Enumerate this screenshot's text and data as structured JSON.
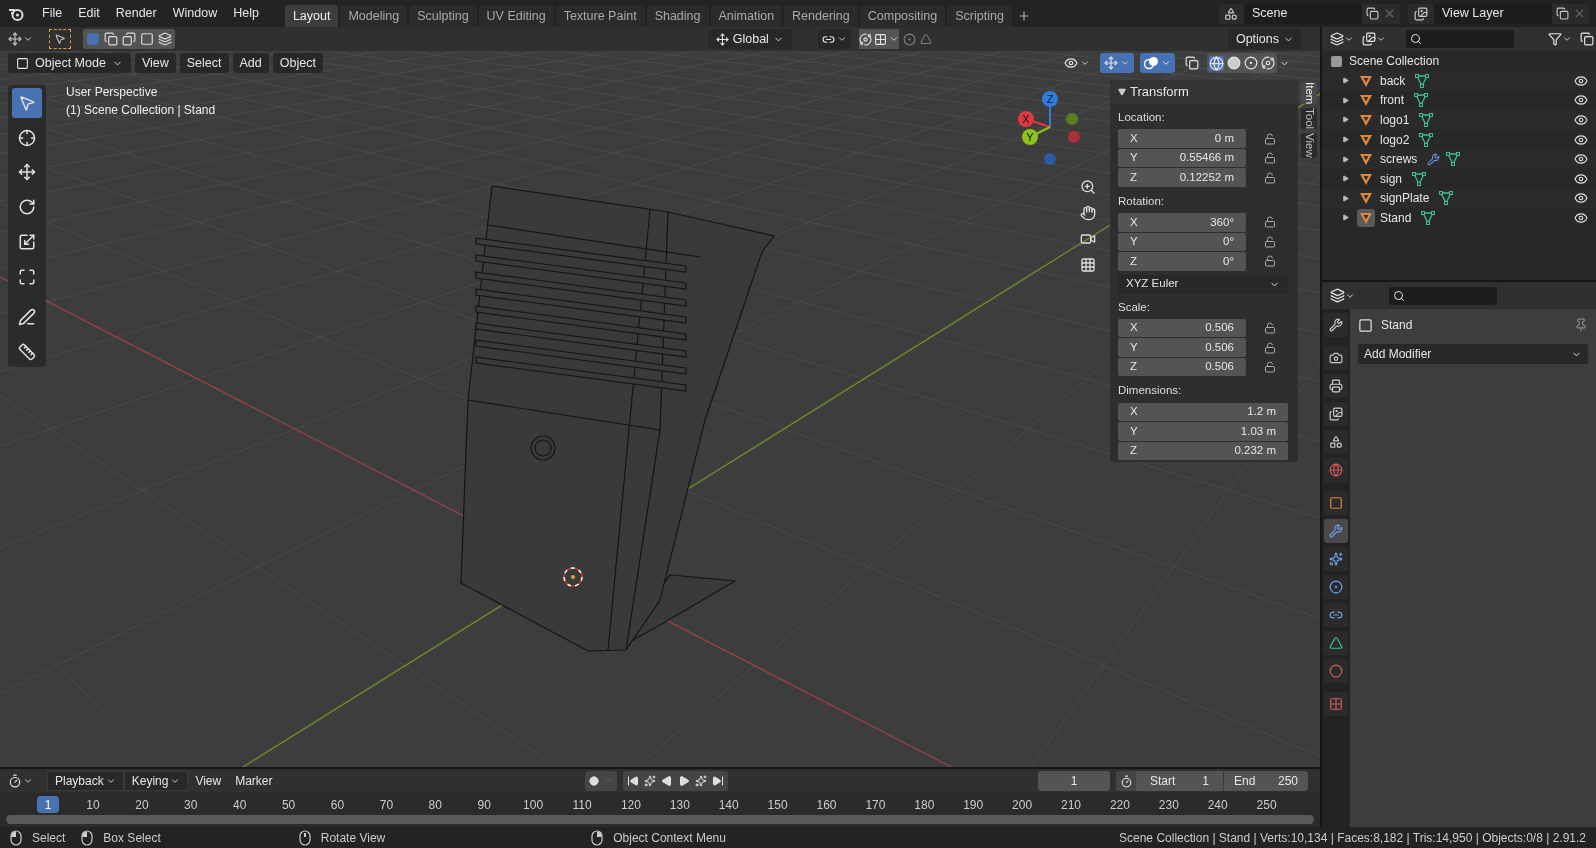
{
  "menu": [
    "File",
    "Edit",
    "Render",
    "Window",
    "Help"
  ],
  "workspaces": [
    {
      "label": "Layout",
      "selected": true
    },
    {
      "label": "Modeling",
      "selected": false
    },
    {
      "label": "Sculpting",
      "selected": false
    },
    {
      "label": "UV Editing",
      "selected": false
    },
    {
      "label": "Texture Paint",
      "selected": false
    },
    {
      "label": "Shading",
      "selected": false
    },
    {
      "label": "Animation",
      "selected": false
    },
    {
      "label": "Rendering",
      "selected": false
    },
    {
      "label": "Compositing",
      "selected": false
    },
    {
      "label": "Scripting",
      "selected": false
    }
  ],
  "scene": "Scene",
  "view_layer": "View Layer",
  "tool_header": {
    "orientation": "Global",
    "snap_on": true,
    "options": "Options"
  },
  "viewport_header": {
    "mode": "Object Mode",
    "menus": [
      "View",
      "Select",
      "Add",
      "Object"
    ],
    "gizmos_on": true,
    "overlays_on": true
  },
  "viewport_info": [
    "User Perspective",
    "(1) Scene Collection | Stand"
  ],
  "tools": [
    {
      "kind": "select",
      "selected": true
    },
    {
      "kind": "cursor",
      "selected": false
    },
    {
      "kind": "move",
      "selected": false
    },
    {
      "kind": "rotate",
      "selected": false
    },
    {
      "kind": "scale",
      "selected": false
    },
    {
      "kind": "transform",
      "selected": false
    },
    {
      "kind": "annotate",
      "selected": false
    },
    {
      "kind": "measure",
      "selected": false
    }
  ],
  "gizmo": [
    {
      "label": "Z",
      "color": "#2f7ce0"
    },
    {
      "label": "X",
      "color": "#e0393d"
    },
    {
      "label": "Y",
      "color": "#8cc31b"
    }
  ],
  "n_panel": {
    "tabs": [
      {
        "label": "Item",
        "selected": true
      },
      {
        "label": "Tool",
        "selected": false
      },
      {
        "label": "View",
        "selected": false
      }
    ],
    "title": "Transform",
    "sections": [
      {
        "label": "Location:",
        "locks": true,
        "fields": [
          {
            "axis": "X",
            "value": "0 m"
          },
          {
            "axis": "Y",
            "value": "0.55466 m"
          },
          {
            "axis": "Z",
            "value": "0.12252 m"
          }
        ]
      },
      {
        "label": "Rotation:",
        "locks": true,
        "fields": [
          {
            "axis": "X",
            "value": "360°"
          },
          {
            "axis": "Y",
            "value": "0°"
          },
          {
            "axis": "Z",
            "value": "0°"
          }
        ],
        "mode": "XYZ Euler"
      },
      {
        "label": "Scale:",
        "locks": true,
        "fields": [
          {
            "axis": "X",
            "value": "0.506"
          },
          {
            "axis": "Y",
            "value": "0.506"
          },
          {
            "axis": "Z",
            "value": "0.506"
          }
        ]
      },
      {
        "label": "Dimensions:",
        "locks": false,
        "fields": [
          {
            "axis": "X",
            "value": "1.2 m"
          },
          {
            "axis": "Y",
            "value": "1.03 m"
          },
          {
            "axis": "Z",
            "value": "0.232 m"
          }
        ]
      }
    ]
  },
  "outliner": {
    "root": "Scene Collection",
    "items": [
      {
        "name": "back",
        "has_modifier": false,
        "selected": false
      },
      {
        "name": "front",
        "has_modifier": false,
        "selected": false
      },
      {
        "name": "logo1",
        "has_modifier": false,
        "selected": false
      },
      {
        "name": "logo2",
        "has_modifier": false,
        "selected": false
      },
      {
        "name": "screws",
        "has_modifier": true,
        "selected": false
      },
      {
        "name": "sign",
        "has_modifier": false,
        "selected": false
      },
      {
        "name": "signPlate",
        "has_modifier": false,
        "selected": false
      },
      {
        "name": "Stand",
        "has_modifier": false,
        "selected": true
      }
    ]
  },
  "properties": {
    "tabs": [
      {
        "kind": "tool",
        "selected": false
      },
      {
        "kind": "render",
        "selected": false
      },
      {
        "kind": "output",
        "selected": false
      },
      {
        "kind": "view_layer",
        "selected": false
      },
      {
        "kind": "scene",
        "selected": false
      },
      {
        "kind": "world",
        "selected": false
      },
      {
        "kind": "object",
        "selected": false
      },
      {
        "kind": "modifiers",
        "selected": true
      },
      {
        "kind": "particles",
        "selected": false
      },
      {
        "kind": "physics",
        "selected": false
      },
      {
        "kind": "constraints",
        "selected": false
      },
      {
        "kind": "data",
        "selected": false
      },
      {
        "kind": "material",
        "selected": false
      },
      {
        "kind": "texture",
        "selected": false
      }
    ],
    "object": "Stand",
    "add_modifier": "Add Modifier"
  },
  "timeline": {
    "menus": [
      {
        "label": "Playback",
        "dropdown": true
      },
      {
        "label": "Keying",
        "dropdown": true
      },
      {
        "label": "View",
        "dropdown": false
      },
      {
        "label": "Marker",
        "dropdown": false
      }
    ],
    "current_frame": "1",
    "start_label": "Start",
    "start": "1",
    "end_label": "End",
    "end": "250",
    "ruler": [
      {
        "label": "1",
        "selected": true
      },
      {
        "label": "10",
        "selected": false
      },
      {
        "label": "20",
        "selected": false
      },
      {
        "label": "30",
        "selected": false
      },
      {
        "label": "40",
        "selected": false
      },
      {
        "label": "50",
        "selected": false
      },
      {
        "label": "60",
        "selected": false
      },
      {
        "label": "70",
        "selected": false
      },
      {
        "label": "80",
        "selected": false
      },
      {
        "label": "90",
        "selected": false
      },
      {
        "label": "100",
        "selected": false
      },
      {
        "label": "110",
        "selected": false
      },
      {
        "label": "120",
        "selected": false
      },
      {
        "label": "130",
        "selected": false
      },
      {
        "label": "140",
        "selected": false
      },
      {
        "label": "150",
        "selected": false
      },
      {
        "label": "160",
        "selected": false
      },
      {
        "label": "170",
        "selected": false
      },
      {
        "label": "180",
        "selected": false
      },
      {
        "label": "190",
        "selected": false
      },
      {
        "label": "200",
        "selected": false
      },
      {
        "label": "210",
        "selected": false
      },
      {
        "label": "220",
        "selected": false
      },
      {
        "label": "230",
        "selected": false
      },
      {
        "label": "240",
        "selected": false
      },
      {
        "label": "250",
        "selected": false
      }
    ]
  },
  "status": {
    "hints": [
      {
        "kind": "left",
        "label": "Select"
      },
      {
        "kind": "drag",
        "label": "Box Select"
      },
      {
        "kind": "middle",
        "label": "Rotate View"
      },
      {
        "kind": "right",
        "label": "Object Context Menu"
      }
    ],
    "stats": "Scene Collection | Stand | Verts:10,134 | Faces:8,182 | Tris:14,950 | Objects:0/8 | 2.91.2"
  }
}
